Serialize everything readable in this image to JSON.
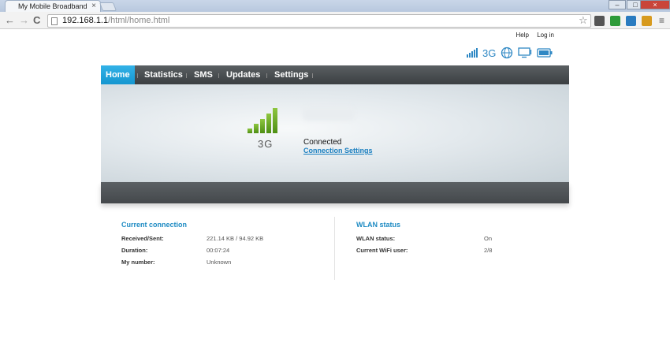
{
  "browser": {
    "tab_title": "My Mobile Broadband",
    "tab_close": "×",
    "url_host": "192.168.1.1",
    "url_path": "/html/home.html",
    "back": "←",
    "forward": "→",
    "reload": "C",
    "star": "☆",
    "menu": "≡",
    "win_min": "–",
    "win_max": "□",
    "win_close": "×"
  },
  "header": {
    "help": "Help",
    "login": "Log in",
    "network_type": "3G"
  },
  "nav": {
    "items": [
      {
        "label": "Home"
      },
      {
        "label": "Statistics"
      },
      {
        "label": "SMS"
      },
      {
        "label": "Updates"
      },
      {
        "label": "Settings"
      }
    ]
  },
  "hero": {
    "signal_level": 5,
    "network_type": "3G",
    "status": "Connected",
    "settings_link": "Connection Settings"
  },
  "current_connection": {
    "title": "Current connection",
    "rows": [
      {
        "label": "Received/Sent:",
        "value": "221.14 KB / 94.92 KB"
      },
      {
        "label": "Duration:",
        "value": "00:07:24"
      },
      {
        "label": "My number:",
        "value": "Unknown"
      }
    ]
  },
  "wlan_status": {
    "title": "WLAN status",
    "rows": [
      {
        "label": "WLAN status:",
        "value": "On"
      },
      {
        "label": "Current WiFi user:",
        "value": "2/8"
      }
    ]
  },
  "colors": {
    "accent": "#1e8bc3",
    "nav_active": "#1596d0",
    "signal_green": "#6aab2a"
  }
}
